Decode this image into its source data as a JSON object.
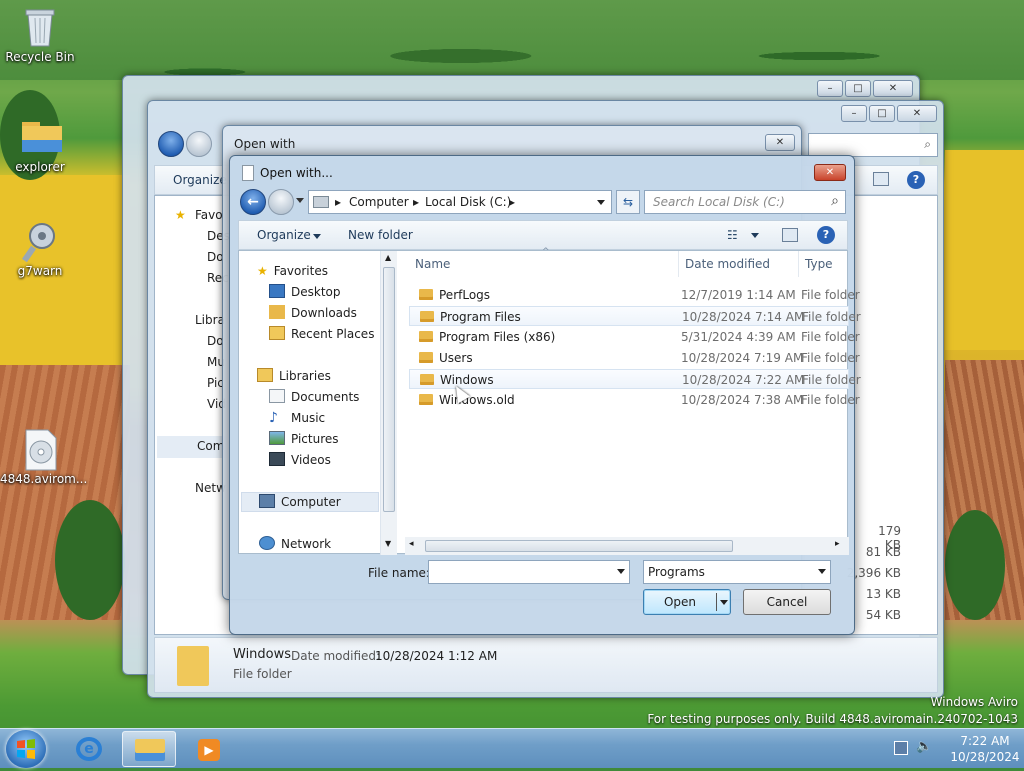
{
  "desktop": {
    "icons": [
      {
        "label": "Recycle Bin"
      },
      {
        "label": "explorer"
      },
      {
        "label": "g7warn"
      },
      {
        "label": "4848.avirom..."
      }
    ],
    "watermark_line1": "Windows Aviro",
    "watermark_line2": "For testing purposes only. Build 4848.aviromain.240702-1043"
  },
  "taskbar": {
    "time": "7:22 AM",
    "date": "10/28/2024"
  },
  "back_explorer": {
    "organize": "Organize",
    "nav": [
      "Favo",
      "Des",
      "Do",
      "Rec",
      "Libra",
      "Do",
      "Mu",
      "Pic",
      "Vid",
      "Com",
      "Netw"
    ],
    "sizes": [
      "179 KB",
      "81 KB",
      "2,396 KB",
      "13 KB",
      "54 KB",
      "54 KB"
    ],
    "details_name": "Windows",
    "details_date_label": "Date modified:",
    "details_date_value": "10/28/2024 1:12 AM",
    "details_type": "File folder"
  },
  "open_with_window": {
    "title": "Open with"
  },
  "dialog": {
    "title": "Open with...",
    "breadcrumb": [
      "Computer",
      "Local Disk (C:)"
    ],
    "search_placeholder": "Search Local Disk (C:)",
    "toolbar": {
      "organize": "Organize",
      "new_folder": "New folder"
    },
    "nav": {
      "favorites": "Favorites",
      "desktop": "Desktop",
      "downloads": "Downloads",
      "recent": "Recent Places",
      "libraries": "Libraries",
      "documents": "Documents",
      "music": "Music",
      "pictures": "Pictures",
      "videos": "Videos",
      "computer": "Computer",
      "network": "Network"
    },
    "columns": {
      "name": "Name",
      "date": "Date modified",
      "type": "Type"
    },
    "rows": [
      {
        "name": "PerfLogs",
        "date": "12/7/2019 1:14 AM",
        "type": "File folder"
      },
      {
        "name": "Program Files",
        "date": "10/28/2024 7:14 AM",
        "type": "File folder"
      },
      {
        "name": "Program Files (x86)",
        "date": "5/31/2024 4:39 AM",
        "type": "File folder"
      },
      {
        "name": "Users",
        "date": "10/28/2024 7:19 AM",
        "type": "File folder"
      },
      {
        "name": "Windows",
        "date": "10/28/2024 7:22 AM",
        "type": "File folder"
      },
      {
        "name": "Windows.old",
        "date": "10/28/2024 7:38 AM",
        "type": "File folder"
      }
    ],
    "file_name_label": "File name:",
    "file_name_value": "",
    "filter_value": "Programs",
    "open_label": "Open",
    "cancel_label": "Cancel"
  }
}
